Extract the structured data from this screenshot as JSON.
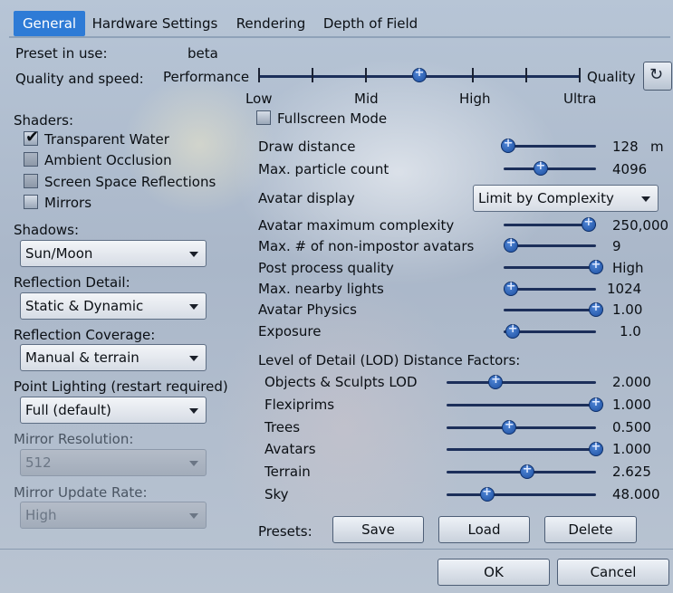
{
  "tabs": [
    {
      "label": "General",
      "active": true
    },
    {
      "label": "Hardware Settings"
    },
    {
      "label": "Rendering"
    },
    {
      "label": "Depth of Field"
    }
  ],
  "preset": {
    "label": "Preset in use:",
    "value": "beta"
  },
  "quality": {
    "label": "Quality and speed:",
    "left_label": "Performance",
    "right_label": "Quality",
    "ticks": [
      "Low",
      "Mid",
      "High",
      "Ultra"
    ],
    "level_fraction": 0.5,
    "reset_icon": "refresh-icon"
  },
  "shaders": {
    "heading": "Shaders:",
    "items": [
      {
        "label": "Transparent Water",
        "checked": true,
        "enabled": true
      },
      {
        "label": "Ambient Occlusion",
        "checked": false,
        "enabled": false
      },
      {
        "label": "Screen Space Reflections",
        "checked": false,
        "enabled": false
      },
      {
        "label": "Mirrors",
        "checked": false,
        "enabled": true
      }
    ]
  },
  "shadows": {
    "label": "Shadows:",
    "value": "Sun/Moon"
  },
  "reflection_detail": {
    "label": "Reflection Detail:",
    "value": "Static & Dynamic"
  },
  "reflection_coverage": {
    "label": "Reflection Coverage:",
    "value": "Manual & terrain"
  },
  "point_lighting": {
    "label": "Point Lighting (restart required)",
    "value": "Full (default)"
  },
  "mirror_resolution": {
    "label": "Mirror Resolution:",
    "value": "512"
  },
  "mirror_update_rate": {
    "label": "Mirror Update Rate:",
    "value": "High"
  },
  "fullscreen": {
    "label": "Fullscreen Mode",
    "checked": false
  },
  "draw_distance": {
    "label": "Draw distance",
    "value": "128",
    "unit": "m",
    "fraction": 0.05
  },
  "particles": {
    "label": "Max. particle count",
    "value": "4096",
    "fraction": 0.4
  },
  "avatar_display": {
    "label": "Avatar display",
    "value": "Limit by Complexity"
  },
  "settings": [
    {
      "label": "Avatar maximum complexity",
      "value": "250,000",
      "fraction": 0.92
    },
    {
      "label": "Max. # of non-impostor avatars",
      "value": "9",
      "fraction": 0.08
    },
    {
      "label": "Post process quality",
      "value": "High",
      "fraction": 1.0
    },
    {
      "label": "Max. nearby lights",
      "value": "1024",
      "fraction": 0.08
    },
    {
      "label": "Avatar Physics",
      "value": "1.00",
      "fraction": 1.0
    },
    {
      "label": "Exposure",
      "value": "1.0",
      "fraction": 0.1
    }
  ],
  "lod": {
    "heading": "Level of Detail (LOD) Distance Factors:",
    "items": [
      {
        "label": "Objects & Sculpts LOD",
        "value": "2.000",
        "fraction": 0.33
      },
      {
        "label": "Flexiprims",
        "value": "1.000",
        "fraction": 1.0
      },
      {
        "label": "Trees",
        "value": "0.500",
        "fraction": 0.42
      },
      {
        "label": "Avatars",
        "value": "1.000",
        "fraction": 1.0
      },
      {
        "label": "Terrain",
        "value": "2.625",
        "fraction": 0.54
      },
      {
        "label": "Sky",
        "value": "48.000",
        "fraction": 0.27
      }
    ]
  },
  "presets": {
    "label": "Presets:",
    "save": "Save",
    "load": "Load",
    "delete": "Delete"
  },
  "footer": {
    "ok": "OK",
    "cancel": "Cancel"
  }
}
